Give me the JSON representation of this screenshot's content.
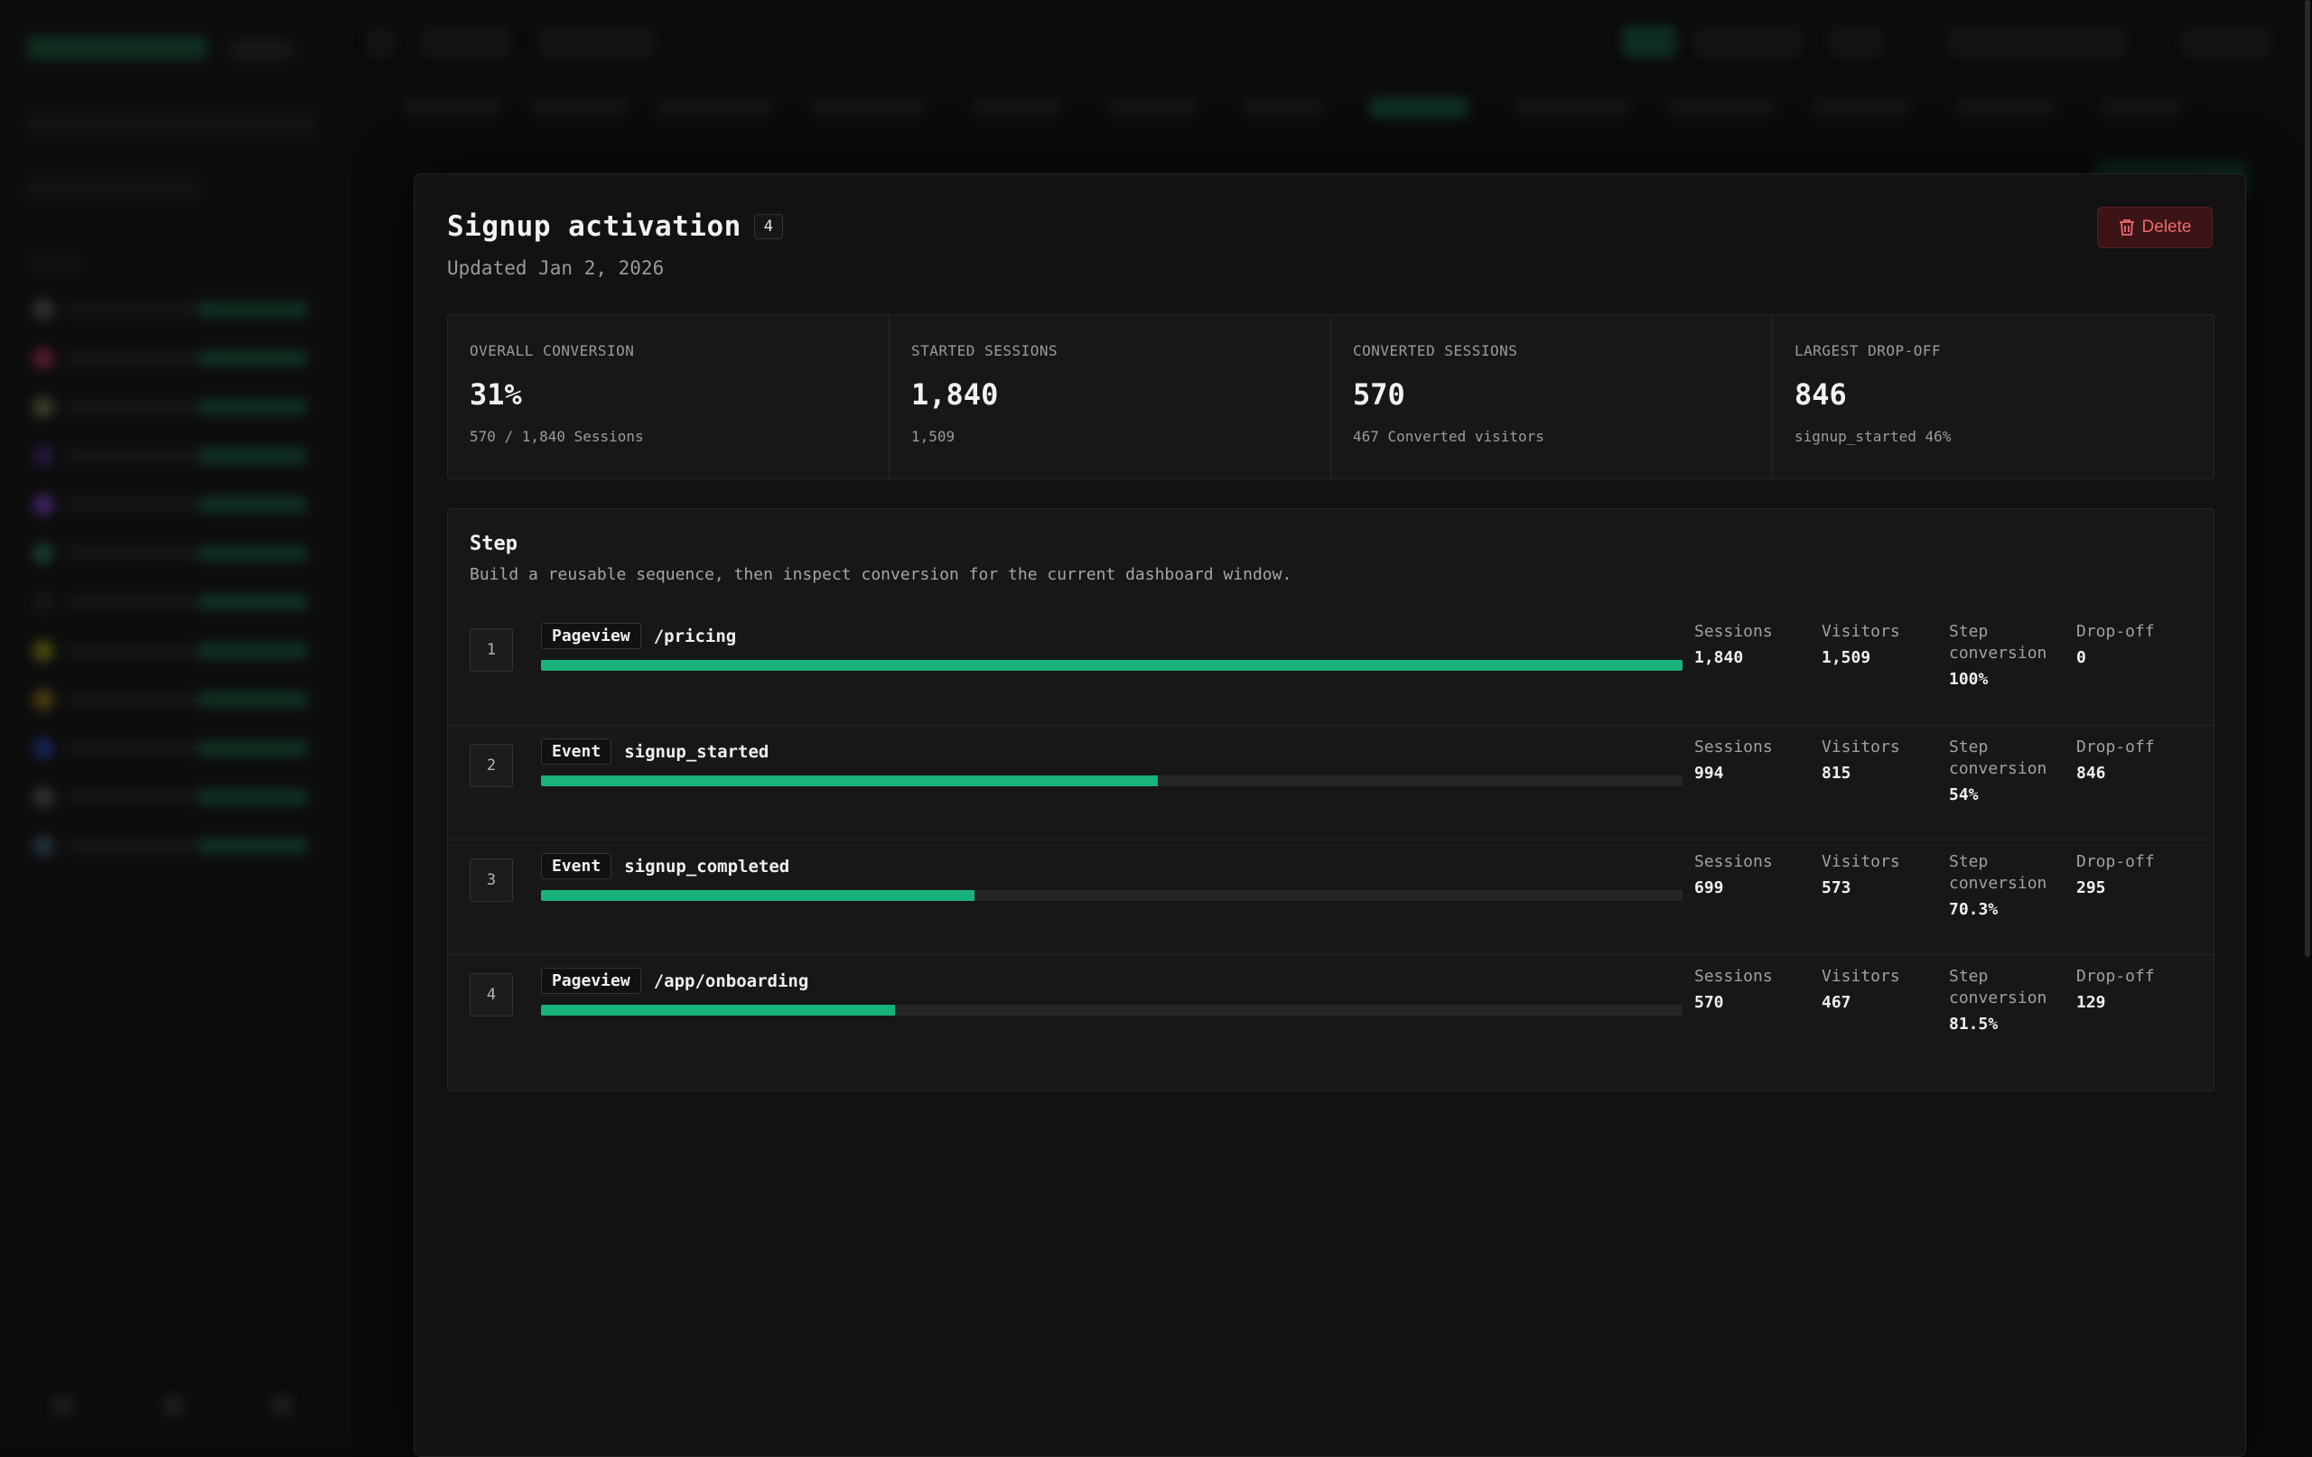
{
  "funnel": {
    "title": "Signup activation",
    "step_count": "4",
    "updated": "Updated Jan 2, 2026",
    "delete_label": "Delete"
  },
  "stats": [
    {
      "label": "OVERALL CONVERSION",
      "value": "31%",
      "sub": "570 / 1,840 Sessions"
    },
    {
      "label": "STARTED SESSIONS",
      "value": "1,840",
      "sub": "1,509"
    },
    {
      "label": "CONVERTED SESSIONS",
      "value": "570",
      "sub": "467 Converted visitors"
    },
    {
      "label": "LARGEST DROP-OFF",
      "value": "846",
      "sub": "signup_started 46%"
    }
  ],
  "steps_panel": {
    "title": "Step",
    "description": "Build a reusable sequence, then inspect conversion for the current dashboard window.",
    "metric_labels": {
      "sessions": "Sessions",
      "visitors": "Visitors",
      "step_conversion_1": "Step",
      "step_conversion_2": "conversion",
      "dropoff": "Drop-off"
    },
    "steps": [
      {
        "num": "1",
        "type": "Pageview",
        "target": "/pricing",
        "sessions": "1,840",
        "visitors": "1,509",
        "conversion": "100%",
        "dropoff": "0",
        "fill": 1.0
      },
      {
        "num": "2",
        "type": "Event",
        "target": "signup_started",
        "sessions": "994",
        "visitors": "815",
        "conversion": "54%",
        "dropoff": "846",
        "fill": 0.54
      },
      {
        "num": "3",
        "type": "Event",
        "target": "signup_completed",
        "sessions": "699",
        "visitors": "573",
        "conversion": "70.3%",
        "dropoff": "295",
        "fill": 0.38
      },
      {
        "num": "4",
        "type": "Pageview",
        "target": "/app/onboarding",
        "sessions": "570",
        "visitors": "467",
        "conversion": "81.5%",
        "dropoff": "129",
        "fill": 0.31
      }
    ]
  },
  "colors": {
    "accent": "#19b27b",
    "danger_text": "#f0686b",
    "danger_bg": "#3a1416"
  },
  "icons": {
    "delete": "trash-icon"
  }
}
